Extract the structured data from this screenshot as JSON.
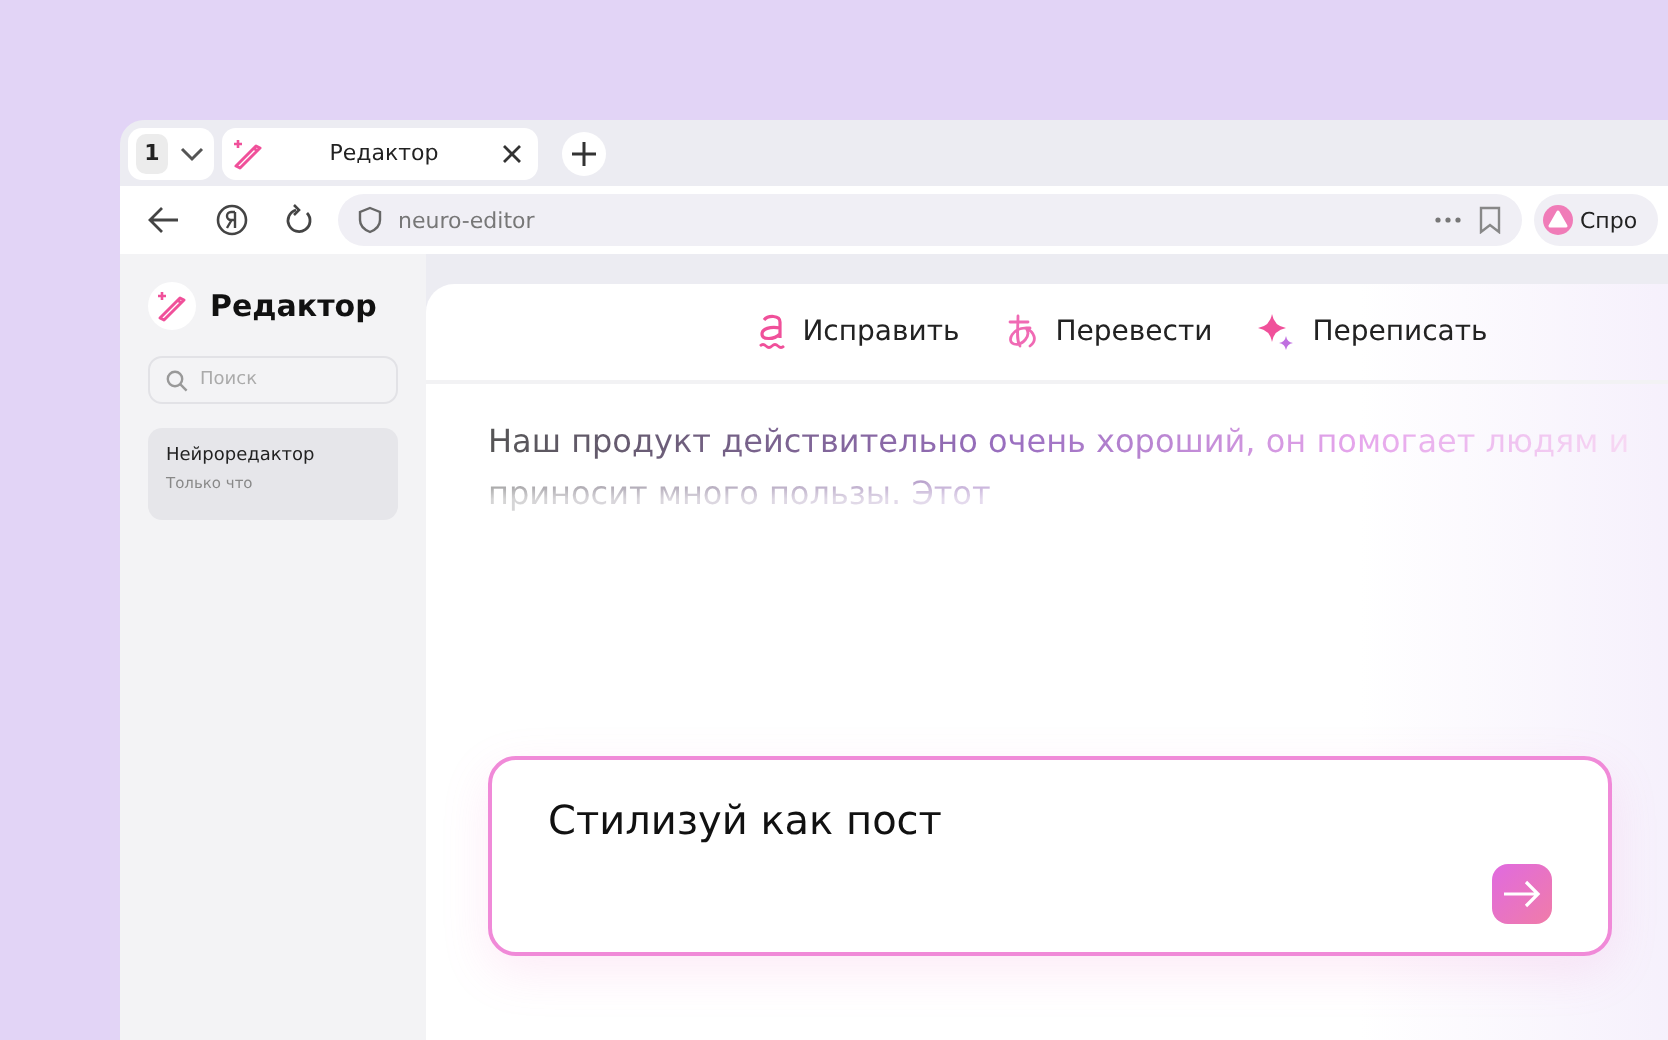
{
  "browser": {
    "tab_counter": "1",
    "tabs": [
      {
        "label": "Редактор",
        "selected": true
      }
    ],
    "address": "neuro-editor",
    "assistant_button": "Спро"
  },
  "sidebar": {
    "title": "Редактор",
    "search": {
      "placeholder": "Поиск"
    },
    "chats": [
      {
        "title": "Нейроредактор",
        "time": "Только что",
        "selected": true
      }
    ]
  },
  "toolbar": [
    {
      "label": "Исправить",
      "kind": "fix"
    },
    {
      "label": "Перевести",
      "kind": "translate"
    },
    {
      "label": "Переписать",
      "kind": "rewrite"
    }
  ],
  "document": {
    "text": "Наш продукт действительно очень хороший, он помогает людям и приносит много пользы. Этот"
  },
  "prompt": {
    "value": "Стилизуй как пост"
  }
}
